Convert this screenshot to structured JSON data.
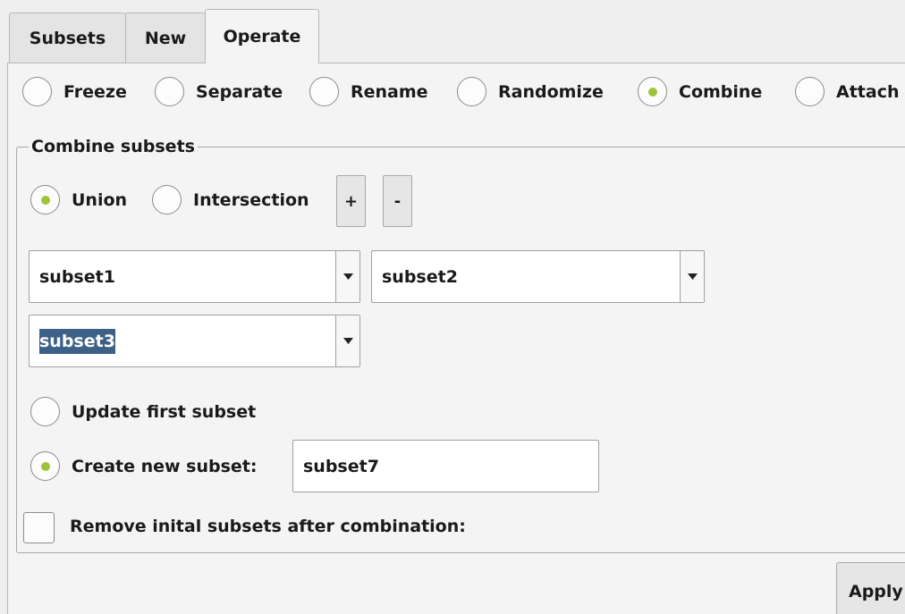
{
  "tabs": [
    {
      "label": "Subsets",
      "active": false
    },
    {
      "label": "New",
      "active": false
    },
    {
      "label": "Operate",
      "active": true
    }
  ],
  "operations": [
    {
      "label": "Freeze",
      "selected": false
    },
    {
      "label": "Separate",
      "selected": false
    },
    {
      "label": "Rename",
      "selected": false
    },
    {
      "label": "Randomize",
      "selected": false
    },
    {
      "label": "Combine",
      "selected": true
    },
    {
      "label": "Attach",
      "selected": false
    }
  ],
  "combine": {
    "group_title": "Combine subsets",
    "mode_options": [
      {
        "label": "Union",
        "selected": true
      },
      {
        "label": "Intersection",
        "selected": false
      }
    ],
    "add_label": "+",
    "remove_label": "-",
    "subset_selects": [
      {
        "value": "subset1",
        "highlighted": false
      },
      {
        "value": "subset2",
        "highlighted": false
      },
      {
        "value": "subset3",
        "highlighted": true
      }
    ],
    "result_options": [
      {
        "label": "Update first subset",
        "selected": false
      },
      {
        "label": "Create new subset:",
        "selected": true
      }
    ],
    "new_subset_name": "subset7",
    "remove_initial_label": "Remove inital subsets after combination:",
    "remove_initial_checked": false,
    "apply_label": "Apply"
  },
  "colors": {
    "radio_selected_dot": "#9dc33b",
    "selection_highlight": "#3d6186",
    "background": "#efefef"
  }
}
